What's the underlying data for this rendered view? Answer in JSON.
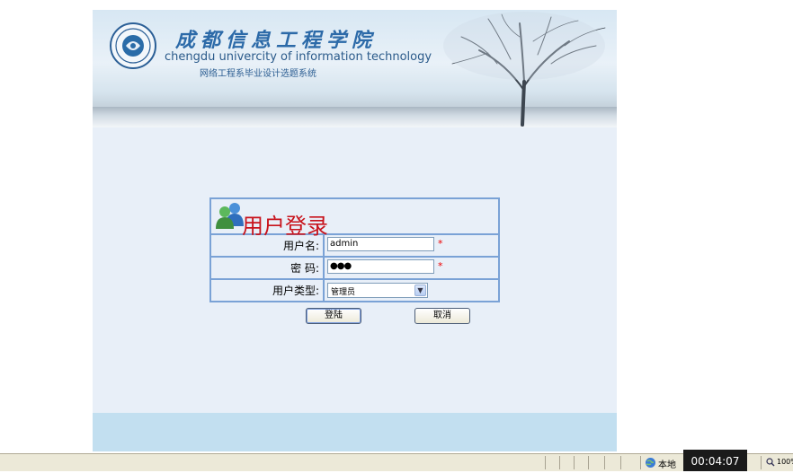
{
  "header": {
    "school_name_cn": "成都信息工程学院",
    "school_name_en": "chengdu univercity of information technology",
    "system_name": "网络工程系毕业设计选题系统"
  },
  "login": {
    "title": "用户登录",
    "username_label": "用户名:",
    "username_value": "admin",
    "password_label": "密  码:",
    "password_value": "●●●",
    "user_type_label": "用户类型:",
    "user_type_value": "管理员",
    "required_mark": "*",
    "login_button": "登陆",
    "cancel_button": "取消"
  },
  "statusbar": {
    "zone_label": "本地",
    "zoom_label": "100%",
    "timer": "00:04:07"
  },
  "colors": {
    "accent_blue": "#7aa2d6",
    "title_red": "#c8121b",
    "page_bg": "#e8eff8"
  },
  "icons": [
    "school-seal-logo",
    "users-icon",
    "select-arrow-icon",
    "internet-zone-icon",
    "zoom-icon"
  ]
}
